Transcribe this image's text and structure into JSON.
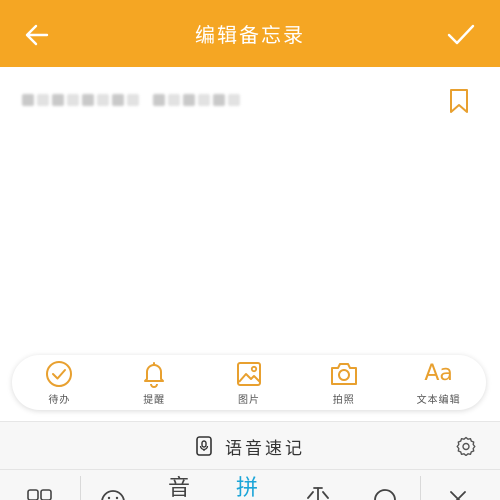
{
  "header": {
    "title": "编辑备忘录",
    "back_icon": "arrow-left-icon",
    "confirm_icon": "check-icon",
    "background": "#F5A623"
  },
  "editor": {
    "content": "",
    "bookmark_icon": "bookmark-icon"
  },
  "toolbar": {
    "items": [
      {
        "label": "待办",
        "icon": "check-circle-icon"
      },
      {
        "label": "提醒",
        "icon": "bell-icon"
      },
      {
        "label": "图片",
        "icon": "image-icon"
      },
      {
        "label": "拍照",
        "icon": "camera-icon"
      },
      {
        "label": "文本编辑",
        "icon": "text-format-icon",
        "glyph": "Aa"
      }
    ],
    "accent": "#E8A02F"
  },
  "voice": {
    "label": "语音速记",
    "icon": "voice-recorder-icon",
    "settings_icon": "gear-icon"
  },
  "keyboard": {
    "items": [
      {
        "name": "layout-grid-icon"
      },
      {
        "name": "emoji-icon"
      },
      {
        "text": "音"
      },
      {
        "text": "拼"
      },
      {
        "name": "cursor-icon"
      },
      {
        "name": "search-icon"
      },
      {
        "name": "close-icon"
      }
    ],
    "active_color": "#1BA5D8"
  }
}
